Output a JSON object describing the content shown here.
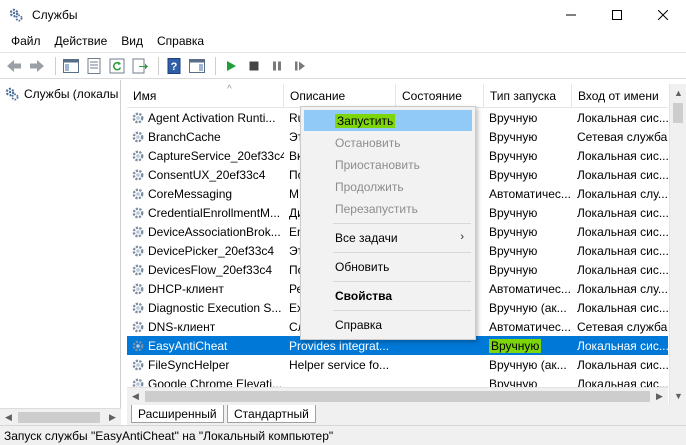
{
  "window": {
    "title": "Службы",
    "icon": "services-gear-icon",
    "controls": {
      "minimize": "minimize-icon",
      "maximize": "maximize-icon",
      "close": "close-icon"
    }
  },
  "menubar": {
    "items": [
      "Файл",
      "Действие",
      "Вид",
      "Справка"
    ]
  },
  "toolbar": {
    "icons": [
      "back-arrow-icon",
      "forward-arrow-icon",
      "console-tree-icon",
      "properties-sheet-icon",
      "refresh-icon",
      "export-list-icon",
      "help-icon",
      "show-hide-pane-icon",
      "start-icon",
      "stop-icon",
      "pause-icon",
      "restart-icon"
    ]
  },
  "tree": {
    "root_label": "Службы (локалы"
  },
  "columns": {
    "name": "Имя",
    "description": "Описание",
    "state": "Состояние",
    "startup": "Тип запуска",
    "logon": "Вход от имени"
  },
  "rows": [
    {
      "name": "Agent Activation Runti...",
      "desc": "Ru",
      "state": "",
      "startup": "Вручную",
      "logon": "Локальная сис..."
    },
    {
      "name": "BranchCache",
      "desc": "Эт",
      "state": "",
      "startup": "Вручную",
      "logon": "Сетевая служба"
    },
    {
      "name": "CaptureService_20ef33c4",
      "desc": "Вк",
      "state": "",
      "startup": "Вручную",
      "logon": "Локальная сис..."
    },
    {
      "name": "ConsentUX_20ef33c4",
      "desc": "По",
      "state": "",
      "startup": "Вручную",
      "logon": "Локальная сис..."
    },
    {
      "name": "CoreMessaging",
      "desc": "М",
      "state": "",
      "startup": "Автоматичес...",
      "logon": "Локальная слу..."
    },
    {
      "name": "CredentialEnrollmentM...",
      "desc": "Ди",
      "state": "",
      "startup": "Вручную",
      "logon": "Локальная сис..."
    },
    {
      "name": "DeviceAssociationBrok...",
      "desc": "En",
      "state": "",
      "startup": "Вручную",
      "logon": "Локальная сис..."
    },
    {
      "name": "DevicePicker_20ef33c4",
      "desc": "Эт",
      "state": "",
      "startup": "Вручную",
      "logon": "Локальная сис..."
    },
    {
      "name": "DevicesFlow_20ef33c4",
      "desc": "По",
      "state": "",
      "startup": "Вручную",
      "logon": "Локальная сис..."
    },
    {
      "name": "DHCP-клиент",
      "desc": "Ре",
      "state": "",
      "startup": "Автоматичес...",
      "logon": "Локальная слу..."
    },
    {
      "name": "Diagnostic Execution S...",
      "desc": "Ex",
      "state": "",
      "startup": "Вручную (ак...",
      "logon": "Локальная сис..."
    },
    {
      "name": "DNS-клиент",
      "desc": "Сл",
      "state": "",
      "startup": "Автоматичес...",
      "logon": "Сетевая служба"
    },
    {
      "name": "EasyAntiCheat",
      "desc": "Provides integrat...",
      "state": "",
      "startup": "Вручную",
      "logon": "Локальная сис...",
      "selected": true
    },
    {
      "name": "FileSyncHelper",
      "desc": "Helper service fo...",
      "state": "",
      "startup": "Вручную (ак...",
      "logon": "Локальная сис..."
    },
    {
      "name": "Google Chrome Elevati...",
      "desc": "",
      "state": "",
      "startup": "Вручную",
      "logon": "Локальная сис..."
    }
  ],
  "context_menu": {
    "items": {
      "start": "Запустить",
      "stop": "Остановить",
      "pause": "Приостановить",
      "resume": "Продолжить",
      "restart": "Перезапустить",
      "all_tasks": "Все задачи",
      "refresh": "Обновить",
      "properties": "Свойства",
      "help": "Справка"
    }
  },
  "tabs": {
    "extended": "Расширенный",
    "standard": "Стандартный"
  },
  "status": {
    "text": "Запуск службы \"EasyAntiCheat\" на \"Локальный компьютер\""
  },
  "colors": {
    "selection": "#0078d7",
    "menu_hover": "#91c9f7",
    "highlight": "#7cd60a",
    "start_green": "#1e9e38"
  }
}
